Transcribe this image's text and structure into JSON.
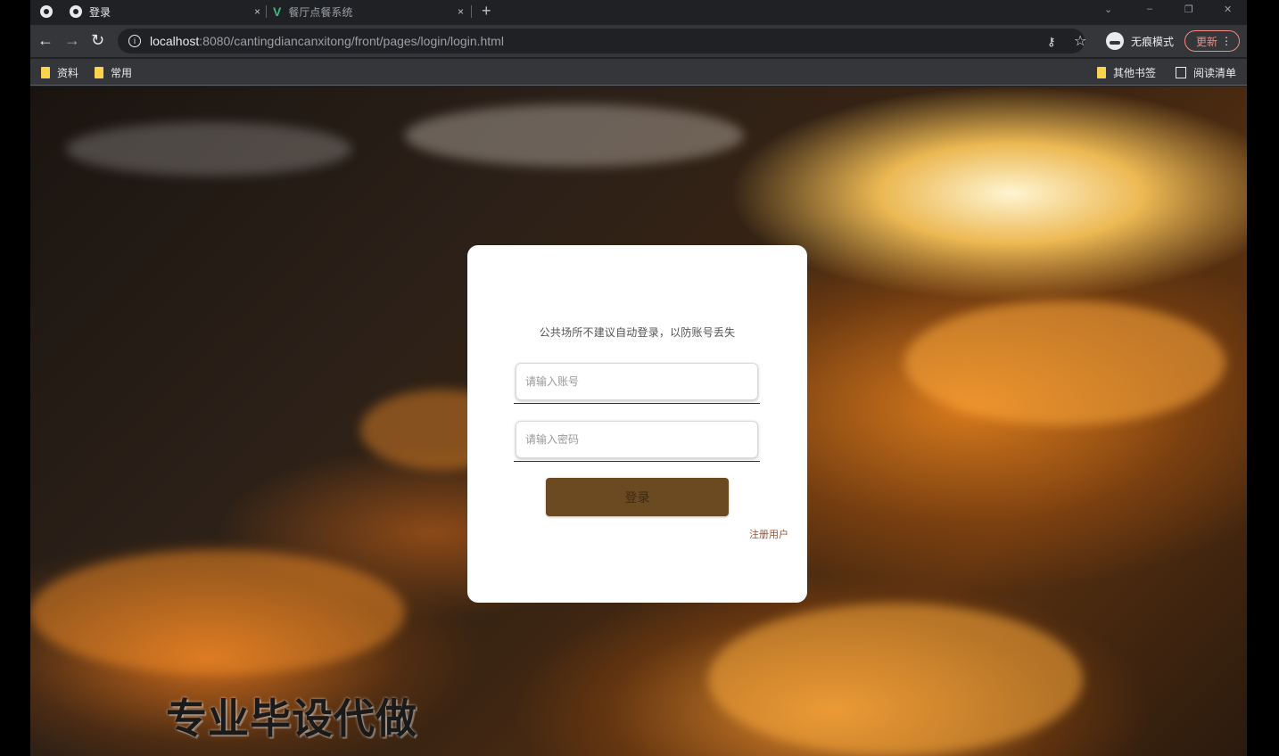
{
  "browser": {
    "tabs": [
      {
        "title": "登录",
        "active": true
      },
      {
        "title": "餐厅点餐系统",
        "active": false
      }
    ],
    "new_tab_label": "+",
    "close_label": "×",
    "url_host": "localhost",
    "url_path": ":8080/cantingdiancanxitong/front/pages/login/login.html",
    "incognito_label": "无痕模式",
    "update_label": "更新",
    "bookmarks": [
      {
        "label": "资料"
      },
      {
        "label": "常用"
      }
    ],
    "other_bookmarks_label": "其他书签",
    "reading_list_label": "阅读清单"
  },
  "login": {
    "hint": "公共场所不建议自动登录，以防账号丢失",
    "username_placeholder": "请输入账号",
    "password_placeholder": "请输入密码",
    "login_button": "登录",
    "register_link": "注册用户"
  },
  "watermark": "专业毕设代做",
  "colors": {
    "button": "#6b4a22",
    "register_link": "#a0522d",
    "card_bg": "#ffffff"
  }
}
